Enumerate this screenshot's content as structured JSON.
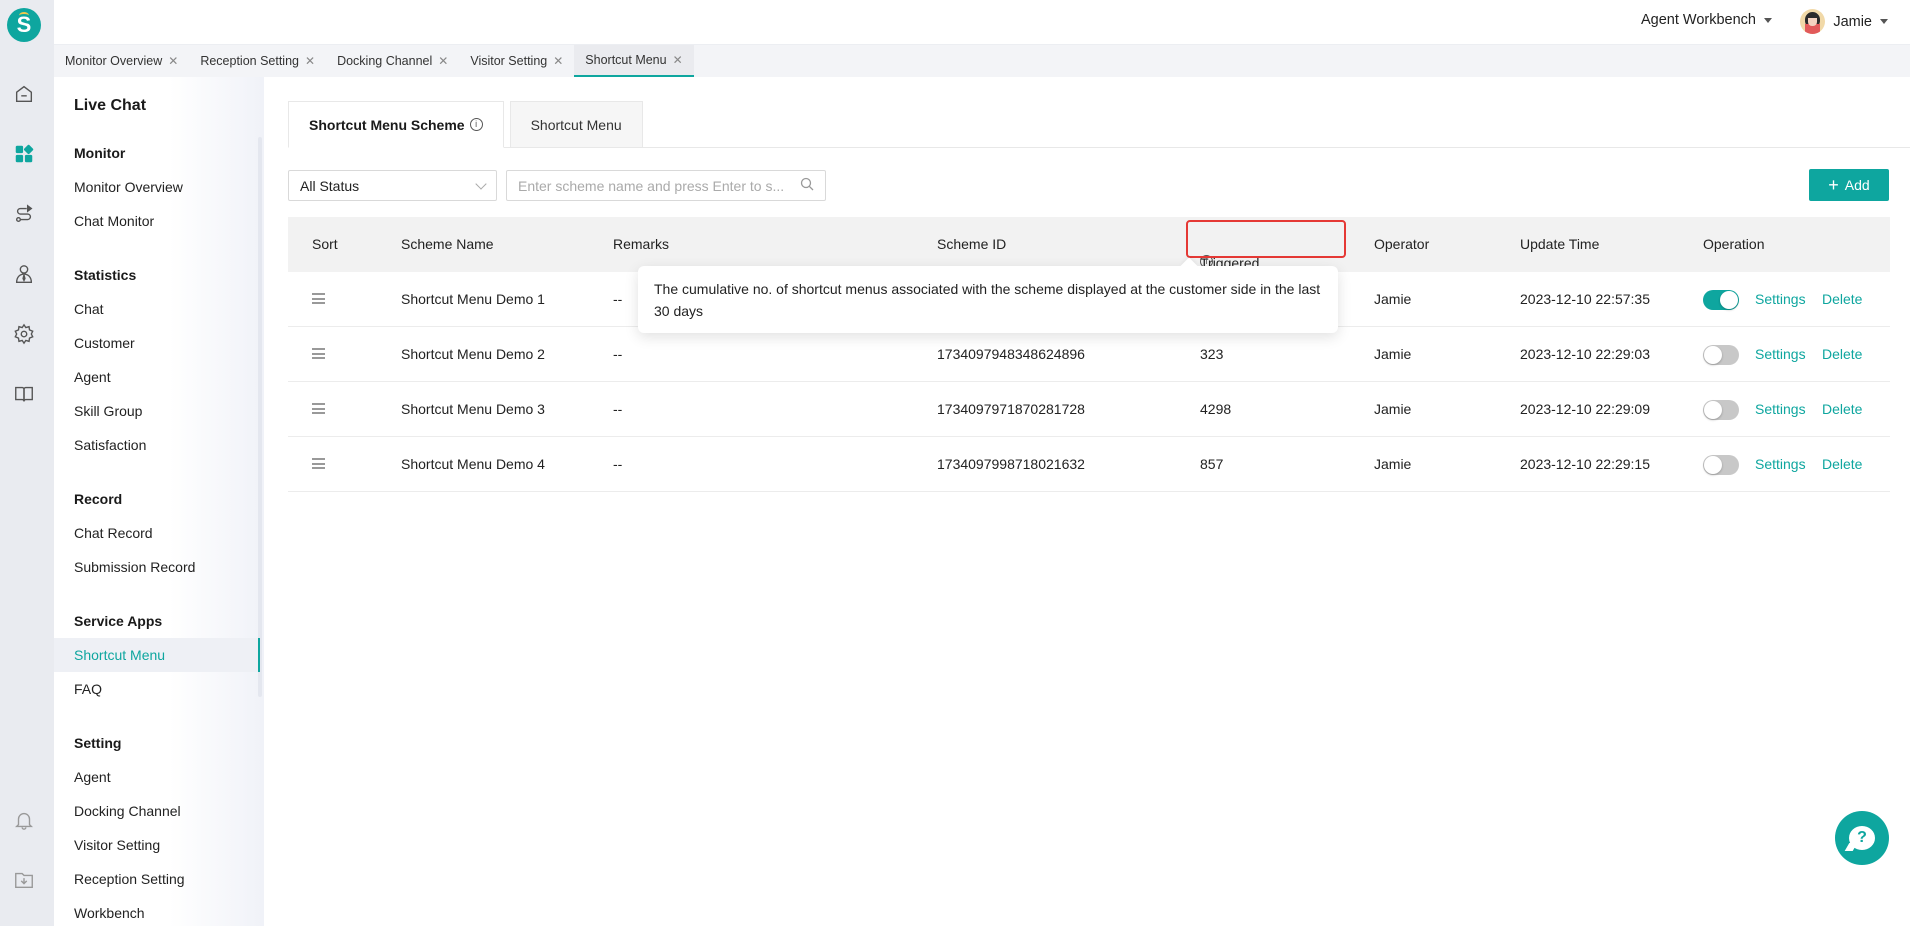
{
  "app": {
    "logo_letter": "S",
    "workbench_label": "Agent Workbench",
    "user_name": "Jamie"
  },
  "rail": {
    "icons": [
      "home-icon",
      "apps-grid-icon",
      "route-icon",
      "agent-icon",
      "gear-icon",
      "book-icon",
      "bell-icon",
      "download-folder-icon"
    ],
    "active": "apps-grid-icon"
  },
  "page_tabs": [
    {
      "label": "Monitor Overview",
      "active": false
    },
    {
      "label": "Reception Setting",
      "active": false
    },
    {
      "label": "Docking Channel",
      "active": false
    },
    {
      "label": "Visitor Setting",
      "active": false
    },
    {
      "label": "Shortcut Menu",
      "active": true
    }
  ],
  "sidebar": {
    "title": "Live Chat",
    "groups": [
      {
        "label": "Monitor",
        "items": [
          "Monitor Overview",
          "Chat Monitor"
        ]
      },
      {
        "label": "Statistics",
        "items": [
          "Chat",
          "Customer",
          "Agent",
          "Skill Group",
          "Satisfaction"
        ]
      },
      {
        "label": "Record",
        "items": [
          "Chat Record",
          "Submission Record"
        ]
      },
      {
        "label": "Service Apps",
        "items": [
          "Shortcut Menu",
          "FAQ"
        ]
      },
      {
        "label": "Setting",
        "items": [
          "Agent",
          "Docking Channel",
          "Visitor Setting",
          "Reception Setting",
          "Workbench"
        ]
      }
    ],
    "active_item": "Shortcut Menu"
  },
  "content_tabs": [
    {
      "label": "Shortcut Menu Scheme",
      "active": true,
      "has_info": true
    },
    {
      "label": "Shortcut Menu",
      "active": false,
      "has_info": false
    }
  ],
  "filters": {
    "status_select": "All Status",
    "search_placeholder": "Enter scheme name and press Enter to s..."
  },
  "add_button": "Add",
  "table": {
    "columns": [
      "Sort",
      "Scheme Name",
      "Remarks",
      "Scheme ID",
      "Triggered Times",
      "Operator",
      "Update Time",
      "Operation"
    ],
    "rows": [
      {
        "name": "Shortcut Menu Demo 1",
        "remarks": "--",
        "scheme_id": "",
        "triggered": "",
        "operator": "Jamie",
        "update_time": "2023-12-10 22:57:35",
        "enabled": true,
        "settings": "Settings",
        "delete": "Delete"
      },
      {
        "name": "Shortcut Menu Demo 2",
        "remarks": "--",
        "scheme_id": "1734097948348624896",
        "triggered": "323",
        "operator": "Jamie",
        "update_time": "2023-12-10 22:29:03",
        "enabled": false,
        "settings": "Settings",
        "delete": "Delete"
      },
      {
        "name": "Shortcut Menu Demo 3",
        "remarks": "--",
        "scheme_id": "1734097971870281728",
        "triggered": "4298",
        "operator": "Jamie",
        "update_time": "2023-12-10 22:29:09",
        "enabled": false,
        "settings": "Settings",
        "delete": "Delete"
      },
      {
        "name": "Shortcut Menu Demo 4",
        "remarks": "--",
        "scheme_id": "1734097998718021632",
        "triggered": "857",
        "operator": "Jamie",
        "update_time": "2023-12-10 22:29:15",
        "enabled": false,
        "settings": "Settings",
        "delete": "Delete"
      }
    ]
  },
  "tooltip": {
    "text": "The cumulative no. of shortcut menus associated with the scheme displayed at the customer side in the last 30 days"
  },
  "colors": {
    "accent": "#0ea69f",
    "highlight_border": "#e53935"
  }
}
